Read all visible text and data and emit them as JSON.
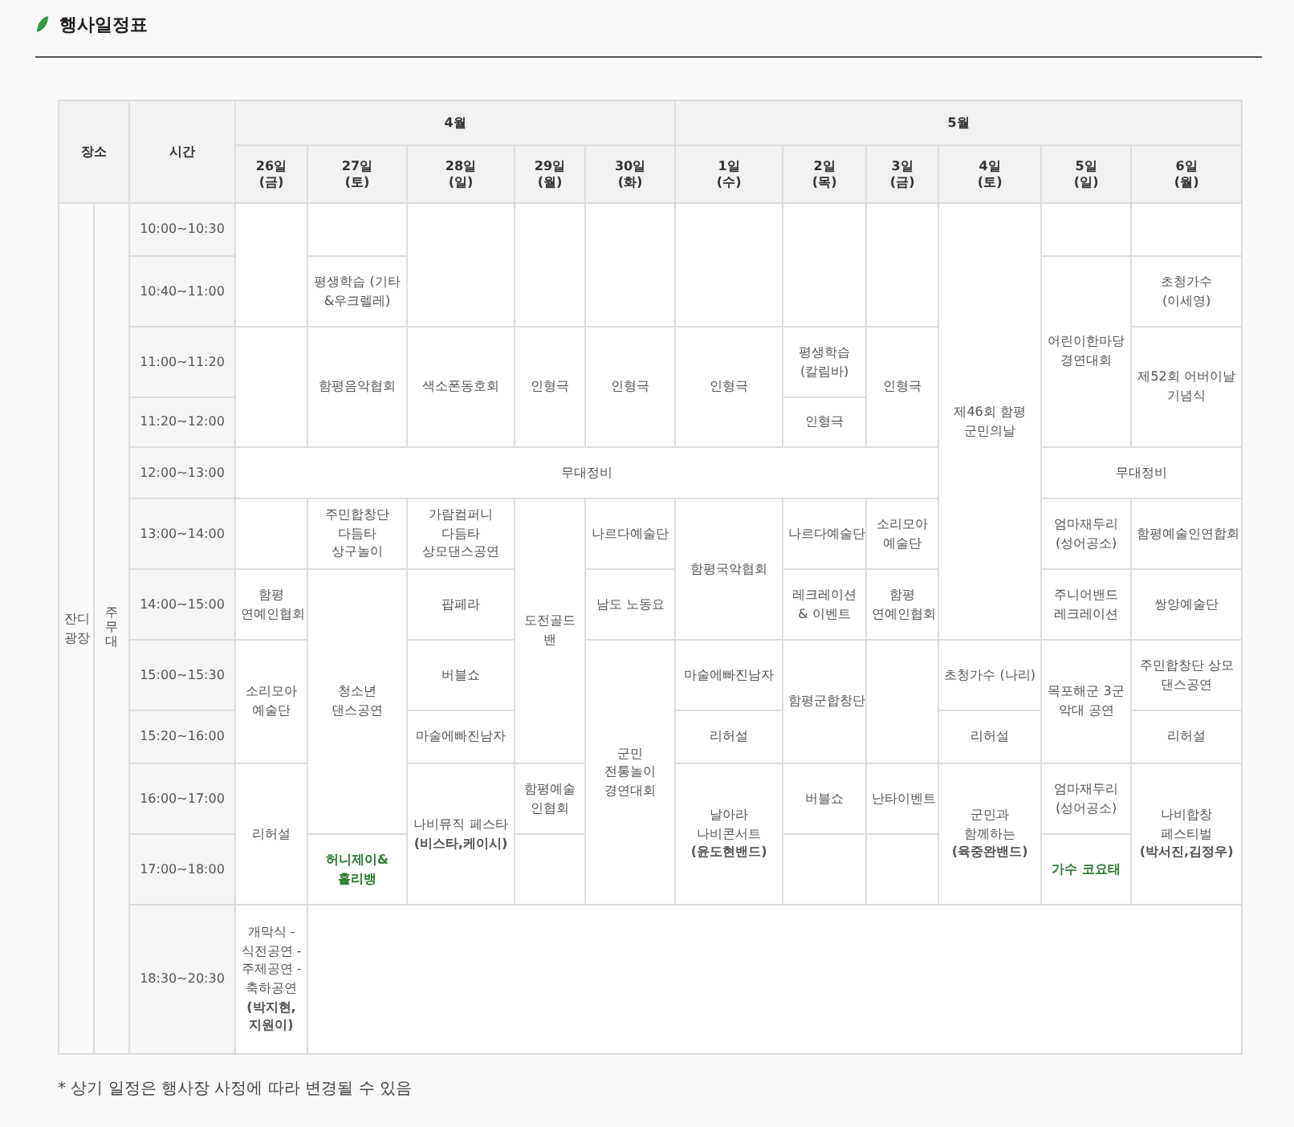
{
  "title": "행사일정표",
  "table": {
    "place_header": "장소",
    "time_header": "시간",
    "months": [
      {
        "label": "4월",
        "days": [
          {
            "day": "26일",
            "weekday": "(금)"
          },
          {
            "day": "27일",
            "weekday": "(토)"
          },
          {
            "day": "28일",
            "weekday": "(일)"
          },
          {
            "day": "29일",
            "weekday": "(월)"
          },
          {
            "day": "30일",
            "weekday": "(화)"
          }
        ]
      },
      {
        "label": "5월",
        "days": [
          {
            "day": "1일",
            "weekday": "(수)"
          },
          {
            "day": "2일",
            "weekday": "(목)"
          },
          {
            "day": "3일",
            "weekday": "(금)"
          },
          {
            "day": "4일",
            "weekday": "(토)"
          },
          {
            "day": "5일",
            "weekday": "(일)"
          },
          {
            "day": "6일",
            "weekday": "(월)"
          }
        ]
      }
    ],
    "place": "잔디 광장",
    "stage": "주무대",
    "rows": [
      {
        "time": "10:00~10:30",
        "cells": [
          {
            "rowspan": 2
          },
          {},
          {
            "rowspan": 2
          },
          {
            "rowspan": 2
          },
          {
            "rowspan": 2
          },
          {
            "rowspan": 2
          },
          {
            "rowspan": 2
          },
          {
            "rowspan": 2
          },
          {
            "text": "제46회 함평 군민의날",
            "rowspan": 7
          },
          {},
          {}
        ]
      },
      {
        "time": "10:40~11:00",
        "cells": [
          {
            "text": "평생학습 (기타&우크렐레)"
          },
          {
            "text": "어린이한마당 경연대회",
            "rowspan": 3
          },
          {
            "text": "초청가수 (이세영)"
          }
        ]
      },
      {
        "time": "11:00~11:20",
        "cells": [
          {
            "rowspan": 2
          },
          {
            "text": "함평음악협회",
            "rowspan": 2
          },
          {
            "text": "색소폰동호회",
            "rowspan": 2
          },
          {
            "text": "인형극",
            "rowspan": 2
          },
          {
            "text": "인형극",
            "rowspan": 2
          },
          {
            "text": "인형극",
            "rowspan": 2
          },
          {
            "text": "평생학습 (칼림바)"
          },
          {
            "text": "인형극",
            "rowspan": 2
          },
          {
            "text": "제52회 어버이날 기념식",
            "rowspan": 2
          }
        ]
      },
      {
        "time": "11:20~12:00",
        "cells": [
          {
            "text": "인형극"
          }
        ]
      },
      {
        "time": "12:00~13:00",
        "cells": [
          {
            "text": "무대정비",
            "colspan": 8
          },
          {
            "text": "무대정비",
            "colspan": 2
          }
        ]
      },
      {
        "time": "13:00~14:00",
        "cells": [
          {},
          {
            "text": "주민합창단 다듬타 상구놀이"
          },
          {
            "text": "가람컴퍼니 다듬타 상모댄스공연"
          },
          {
            "text": "도전골드 밴",
            "rowspan": 4
          },
          {
            "text": "나르다예술단"
          },
          {
            "text": "함평국악협회",
            "rowspan": 2
          },
          {
            "text": "나르다예술단"
          },
          {
            "text": "소리모아 예술단"
          },
          {
            "text": "엄마재두리 (성어공소)"
          },
          {
            "text": "함평예술인연합회"
          }
        ]
      },
      {
        "time": "14:00~15:00",
        "cells": [
          {
            "text": "함평 연예인협회"
          },
          {
            "text": "청소년 댄스공연",
            "rowspan": 4
          },
          {
            "text": "팝페라"
          },
          {
            "text": "남도 노동요"
          },
          {
            "text": "레크레이션 & 이벤트"
          },
          {
            "text": "함평 연예인협회"
          },
          {
            "text": "주니어밴드 레크레이션"
          },
          {
            "text": "쌍앙예술단"
          }
        ]
      },
      {
        "time": "15:00~15:30",
        "cells": [
          {
            "text": "소리모아 예술단",
            "rowspan": 2
          },
          {
            "text": "버블쇼"
          },
          {
            "text": "군민 전통놀이 경연대회",
            "rowspan": 4
          },
          {
            "text": "마술에빠진남자"
          },
          {
            "text": "함평군합창단",
            "rowspan": 2
          },
          {
            "rowspan": 2
          },
          {
            "text": "초청가수 (나리)"
          },
          {
            "text": "목포해군 3군 악대 공연",
            "rowspan": 2
          },
          {
            "text": "주민합창단 상모 댄스공연"
          }
        ]
      },
      {
        "time": "15:20~16:00",
        "cells": [
          {
            "text": "마술에빠진남자"
          },
          {
            "text": "리허설"
          },
          {
            "text": "리허설"
          },
          {
            "text": "리허설"
          }
        ]
      },
      {
        "time": "16:00~17:00",
        "cells": [
          {
            "text": "리허설",
            "rowspan": 2
          },
          {
            "text": "나비뮤직 페스타 **(비스타,케이시)**",
            "rowspan": 2
          },
          {
            "text": "함평예술 인협회"
          },
          {
            "text": "날아라 나비콘서트 **(윤도현밴드)**",
            "rowspan": 2
          },
          {
            "text": "버블쇼"
          },
          {
            "text": "난타이벤트"
          },
          {
            "text": "군민과 함께하는 **(육중완밴드)**",
            "rowspan": 2
          },
          {
            "text": "엄마재두리 (성어공소)"
          },
          {
            "text": "나비합창 페스티벌 **(박서진,김정우)**",
            "rowspan": 2
          }
        ]
      },
      {
        "time": "17:00~18:00",
        "cells": [
          {
            "text": "허니제이&홀리뱅",
            "highlight": true
          },
          {},
          {},
          {},
          {
            "text": "가수 코요태",
            "highlight": true
          }
        ]
      },
      {
        "time": "18:30~20:30",
        "cells": [
          {
            "text": "개막식 - 식전공연 - 주제공연 - 축하공연 **(박지현,지원이)**"
          },
          {
            "colspan": 10
          }
        ]
      }
    ]
  },
  "note": "* 상기 일정은 행사장 사정에 따라 변경될 수 있음"
}
